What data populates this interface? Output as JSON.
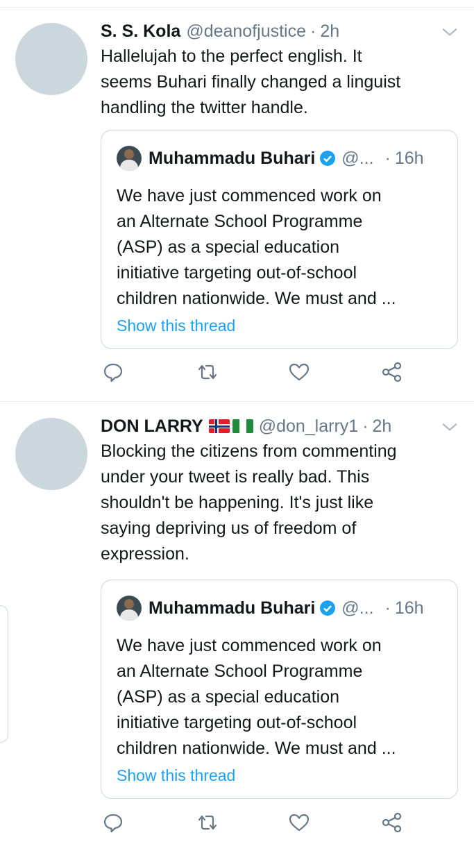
{
  "tweets": [
    {
      "name": "S. S. Kola",
      "handle": "@deanofjustice",
      "time": "2h",
      "text_lines": [
        "Hallelujah to the perfect english. It",
        "seems Buhari finally changed a linguist",
        "handling the twitter handle."
      ],
      "quote": {
        "name": "Muhammadu Buhari",
        "handle": "@...",
        "time": "16h",
        "text_lines": [
          "We have just commenced work on",
          "an Alternate School Programme",
          "(ASP) as a special education",
          "initiative targeting out-of-school",
          "children nationwide. We must and ..."
        ],
        "link": "Show this thread"
      }
    },
    {
      "name": "DON LARRY",
      "handle": "@don_larry1",
      "time": "2h",
      "text_lines": [
        "Blocking the citizens from commenting",
        "under your tweet is really bad. This",
        "shouldn't be happening. It's just like",
        "saying depriving us of freedom of",
        "expression."
      ],
      "quote": {
        "name": "Muhammadu Buhari",
        "handle": "@...",
        "time": "16h",
        "text_lines": [
          "We have just commenced work on",
          "an Alternate School Programme",
          "(ASP) as a special education",
          "initiative targeting out-of-school",
          "children nationwide. We must and ..."
        ],
        "link": "Show this thread"
      }
    }
  ],
  "separator": "·",
  "icons": {
    "reply": "reply-icon",
    "retweet": "retweet-icon",
    "like": "like-icon",
    "share": "share-icon",
    "caret": "chevron-down-icon",
    "verified": "verified-badge-icon"
  },
  "colors": {
    "text": "#14171a",
    "muted": "#657786",
    "link": "#1da1f2",
    "border": "#e6ecf0",
    "avatar_placeholder": "#ccd6dd"
  }
}
